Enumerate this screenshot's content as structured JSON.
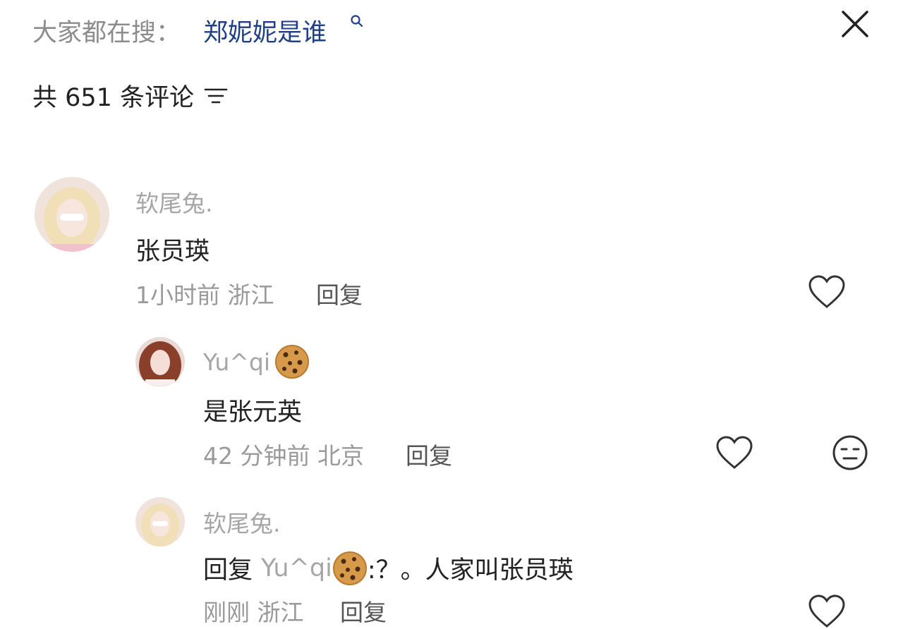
{
  "search": {
    "prefix": "大家都在搜：",
    "term": "郑妮妮是谁"
  },
  "header": {
    "comment_count_label": "共 651 条评论"
  },
  "comments": [
    {
      "user": "软尾兔.",
      "content": "张员瑛",
      "time": "1小时前",
      "location": "浙江",
      "reply_label": "回复"
    },
    {
      "user": "Yu^qi",
      "content": "是张元英",
      "time": "42 分钟前",
      "location": "北京",
      "reply_label": "回复"
    },
    {
      "user": "软尾兔.",
      "reply_prefix": "回复",
      "reply_to": "Yu^qi",
      "content_suffix": ":？。人家叫张员瑛",
      "time": "刚刚",
      "location": "浙江",
      "reply_label": "回复"
    }
  ],
  "icons": [
    "close-icon",
    "sort-icon",
    "search-icon",
    "heart-icon",
    "neutral-face-emoji-icon",
    "cookie-emoji-icon"
  ]
}
